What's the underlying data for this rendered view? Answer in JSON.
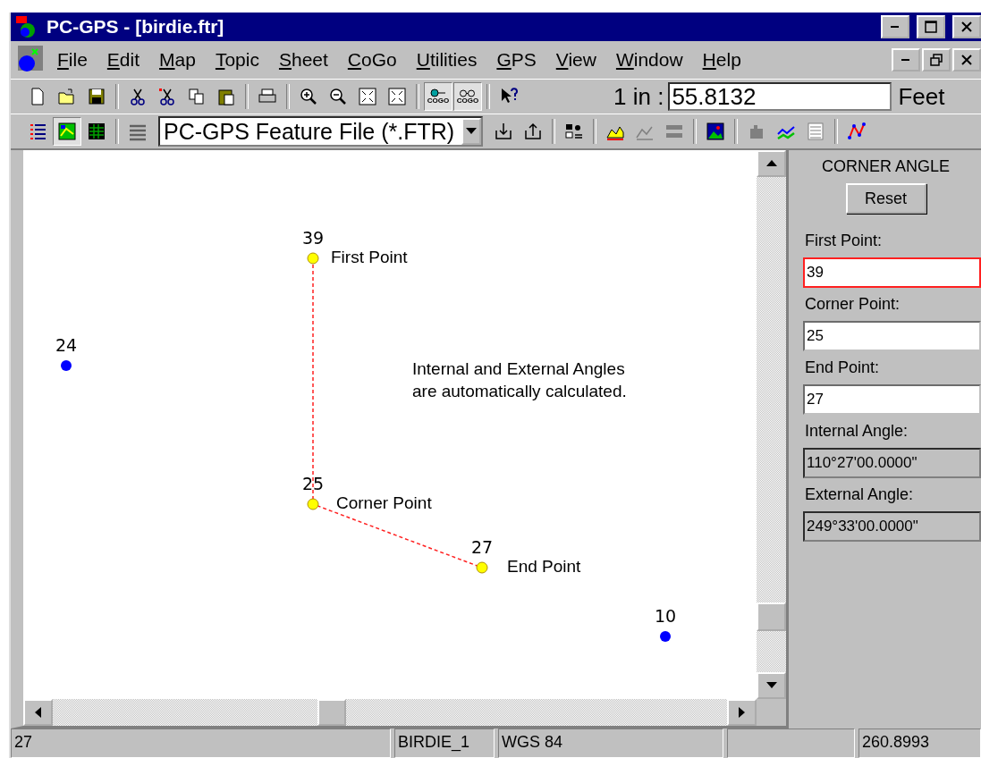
{
  "window": {
    "title": "PC-GPS - [birdie.ftr]"
  },
  "menu": [
    {
      "label": "File"
    },
    {
      "label": "Edit"
    },
    {
      "label": "Map"
    },
    {
      "label": "Topic"
    },
    {
      "label": "Sheet"
    },
    {
      "label": "CoGo"
    },
    {
      "label": "Utilities"
    },
    {
      "label": "GPS"
    },
    {
      "label": "View"
    },
    {
      "label": "Window"
    },
    {
      "label": "Help"
    }
  ],
  "toolbar": {
    "buttons": [
      {
        "kind": "new-document",
        "pressed": false
      },
      {
        "kind": "folder",
        "pressed": false
      },
      {
        "kind": "floppy-disk",
        "pressed": false
      },
      {
        "kind": "separator"
      },
      {
        "kind": "scissors",
        "pressed": false
      },
      {
        "kind": "scissors-dots",
        "pressed": false
      },
      {
        "kind": "copy",
        "pressed": false
      },
      {
        "kind": "clipboard",
        "pressed": false
      },
      {
        "kind": "separator"
      },
      {
        "kind": "printer",
        "pressed": false
      },
      {
        "kind": "separator"
      },
      {
        "kind": "zoom-in",
        "pressed": false
      },
      {
        "kind": "zoom-out",
        "pressed": false
      },
      {
        "kind": "fit-frame",
        "pressed": false
      },
      {
        "kind": "expand-frame",
        "pressed": false
      },
      {
        "kind": "separator"
      },
      {
        "kind": "cogo-target",
        "pressed": true,
        "caption": "COGO"
      },
      {
        "kind": "cogo-glasses",
        "pressed": true,
        "caption": "COGO"
      },
      {
        "kind": "separator"
      },
      {
        "kind": "help-pointer",
        "pressed": false
      }
    ],
    "scale_label": "1 in :",
    "scale_value": "55.8132",
    "unit": "Feet"
  },
  "toolbar2": {
    "buttons": [
      {
        "kind": "list",
        "pressed": false
      },
      {
        "kind": "map",
        "pressed": true
      },
      {
        "kind": "table",
        "pressed": false
      },
      {
        "kind": "separator"
      },
      {
        "kind": "lines",
        "pressed": false
      },
      {
        "kind": "dropdown",
        "value": "PC-GPS Feature File (*.FTR)"
      },
      {
        "kind": "import",
        "pressed": false
      },
      {
        "kind": "export",
        "pressed": false
      },
      {
        "kind": "separator"
      },
      {
        "kind": "query",
        "pressed": false
      },
      {
        "kind": "separator"
      },
      {
        "kind": "profile",
        "pressed": false
      },
      {
        "kind": "profile-faded",
        "pressed": false
      },
      {
        "kind": "bars-faded",
        "pressed": false
      },
      {
        "kind": "separator"
      },
      {
        "kind": "picture",
        "pressed": false
      },
      {
        "kind": "separator"
      },
      {
        "kind": "building",
        "pressed": false
      },
      {
        "kind": "line-graph",
        "pressed": false
      },
      {
        "kind": "grid-faded",
        "pressed": false
      },
      {
        "kind": "separator"
      },
      {
        "kind": "network",
        "pressed": false
      }
    ]
  },
  "map": {
    "points": [
      {
        "label": "39",
        "caption": "First Point",
        "color": "#ffff00",
        "on_path": true
      },
      {
        "label": "24",
        "color": "#0000ff",
        "on_path": false
      },
      {
        "label": "25",
        "caption": "Corner Point",
        "color": "#ffff00",
        "on_path": true
      },
      {
        "label": "27",
        "caption": "End Point",
        "color": "#ffff00",
        "on_path": true
      },
      {
        "label": "10",
        "color": "#0000ff",
        "on_path": false
      }
    ],
    "note": "Internal and External Angles\nare automatically calculated."
  },
  "panel": {
    "title": "CORNER ANGLE",
    "button": "Reset",
    "fields": [
      {
        "label": "First Point:",
        "value": "39",
        "readonly": false,
        "focused": true
      },
      {
        "label": "Corner Point:",
        "value": "25",
        "readonly": false,
        "focused": false
      },
      {
        "label": "End Point:",
        "value": "27",
        "readonly": false,
        "focused": false
      },
      {
        "label": "Internal Angle:",
        "value": "110°27'00.0000\"",
        "readonly": true,
        "focused": false
      },
      {
        "label": "External Angle:",
        "value": "249°33'00.0000\"",
        "readonly": true,
        "focused": false
      }
    ]
  },
  "status_bar": [
    {
      "text": "27"
    },
    {
      "text": "BIRDIE_1"
    },
    {
      "text": "WGS 84"
    },
    {
      "text": "260.8993"
    }
  ]
}
